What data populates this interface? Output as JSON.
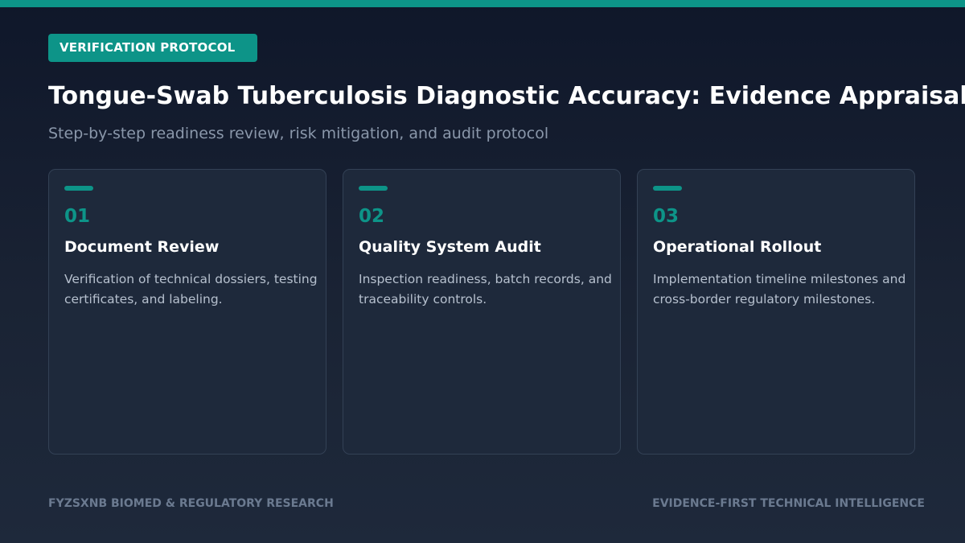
{
  "badge": "VERIFICATION PROTOCOL",
  "title": "Tongue-Swab Tuberculosis Diagnostic Accuracy: Evidence Appraisal of a M",
  "subtitle": "Step-by-step readiness review, risk mitigation, and audit protocol",
  "cards": [
    {
      "number": "01",
      "title": "Document Review",
      "body": "Verification of technical dossiers, testing certificates, and labeling."
    },
    {
      "number": "02",
      "title": "Quality System Audit",
      "body": "Inspection readiness, batch records, and traceability controls."
    },
    {
      "number": "03",
      "title": "Operational Rollout",
      "body": "Implementation timeline milestones and cross-border regulatory milestones."
    }
  ],
  "footer": {
    "left": "FYZSXNB BIOMED & REGULATORY RESEARCH",
    "right": "EVIDENCE-FIRST TECHNICAL INTELLIGENCE"
  },
  "colors": {
    "accent": "#0d9488",
    "background": "#0f172a",
    "card": "#1e293b"
  }
}
